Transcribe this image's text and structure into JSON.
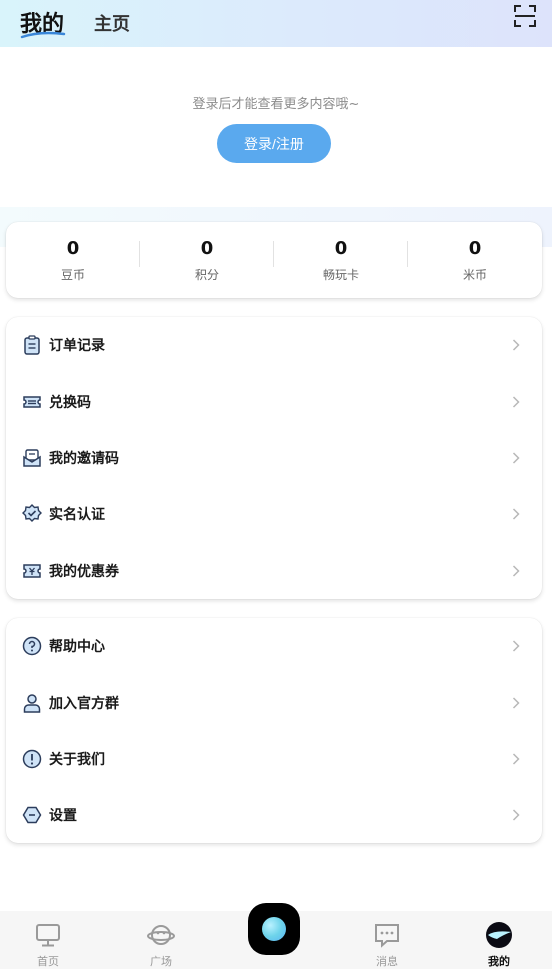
{
  "header": {
    "tab_mine": "我的",
    "tab_home": "主页",
    "scan_icon": "scan-icon"
  },
  "login": {
    "hint": "登录后才能查看更多内容哦~",
    "button_label": "登录/注册"
  },
  "stats": [
    {
      "value": "0",
      "label": "豆币"
    },
    {
      "value": "0",
      "label": "积分"
    },
    {
      "value": "0",
      "label": "畅玩卡"
    },
    {
      "value": "0",
      "label": "米币"
    }
  ],
  "menu_group1": [
    {
      "label": "订单记录",
      "icon": "order-list-icon"
    },
    {
      "label": "兑换码",
      "icon": "ticket-icon"
    },
    {
      "label": "我的邀请码",
      "icon": "invite-icon"
    },
    {
      "label": "实名认证",
      "icon": "verified-badge-icon"
    },
    {
      "label": "我的优惠券",
      "icon": "coupon-icon"
    }
  ],
  "menu_group2": [
    {
      "label": "帮助中心",
      "icon": "help-icon"
    },
    {
      "label": "加入官方群",
      "icon": "group-user-icon"
    },
    {
      "label": "关于我们",
      "icon": "info-icon"
    },
    {
      "label": "设置",
      "icon": "settings-icon"
    }
  ],
  "bottom_nav": [
    {
      "label": "首页",
      "icon": "monitor-icon",
      "active": false
    },
    {
      "label": "广场",
      "icon": "planet-icon",
      "active": false
    },
    {
      "label": "",
      "icon": "create-orb-icon",
      "active": false
    },
    {
      "label": "消息",
      "icon": "message-icon",
      "active": false
    },
    {
      "label": "我的",
      "icon": "profile-icon",
      "active": true
    }
  ],
  "colors": {
    "accent": "#5aa9ee",
    "icon_stroke": "#2c3d5c",
    "icon_fill": "#cfe3f7",
    "chevron": "#b8b8b8"
  }
}
